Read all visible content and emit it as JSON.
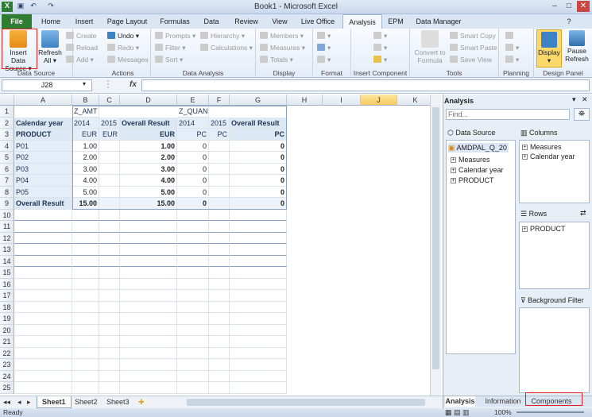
{
  "window": {
    "title": "Book1 - Microsoft Excel"
  },
  "tabs": [
    "File",
    "Home",
    "Insert",
    "Page Layout",
    "Formulas",
    "Data",
    "Review",
    "View",
    "Live Office",
    "Analysis",
    "EPM",
    "Data Manager"
  ],
  "ribbon": {
    "data_source": {
      "label": "Data Source",
      "insert": "Insert Data Source",
      "refresh": "Refresh All"
    },
    "actions": {
      "label": "Actions",
      "create": "Create",
      "reload": "Reload",
      "add": "Add",
      "undo": "Undo",
      "redo": "Redo",
      "messages": "Messages"
    },
    "data_analysis": {
      "label": "Data Analysis",
      "prompts": "Prompts",
      "filter": "Filter",
      "sort": "Sort",
      "hierarchy": "Hierarchy",
      "calculations": "Calculations"
    },
    "display": {
      "label": "Display",
      "members": "Members",
      "measures": "Measures",
      "totals": "Totals"
    },
    "format": {
      "label": "Format"
    },
    "insert_component": {
      "label": "Insert Component"
    },
    "tools": {
      "label": "Tools",
      "convert": "Convert to Formula",
      "smart_copy": "Smart Copy",
      "smart_paste": "Smart Paste",
      "save_view": "Save View"
    },
    "planning": {
      "label": "Planning"
    },
    "design_panel": {
      "label": "Design Panel",
      "display": "Display",
      "pause": "Pause Refresh"
    }
  },
  "formula_bar": {
    "name_box": "J28",
    "fx": "fx",
    "value": ""
  },
  "columns": [
    "A",
    "B",
    "C",
    "D",
    "E",
    "F",
    "G",
    "H",
    "I",
    "J",
    "K"
  ],
  "rows": [
    "1",
    "2",
    "3",
    "4",
    "5",
    "6",
    "7",
    "8",
    "9",
    "10",
    "11",
    "12",
    "13",
    "14",
    "15",
    "16",
    "17",
    "18",
    "19",
    "20",
    "21",
    "22",
    "23",
    "24",
    "25"
  ],
  "table": {
    "r1": {
      "b": "Z_AMT",
      "e": "Z_QUAN"
    },
    "r2": {
      "a": "Calendar year",
      "b": "2014",
      "c": "2015",
      "d": "Overall Result",
      "e": "2014",
      "f": "2015",
      "g": "Overall Result"
    },
    "r3": {
      "a": "PRODUCT",
      "b": "EUR",
      "c": "EUR",
      "d": "EUR",
      "e": "PC",
      "f": "PC",
      "g": "PC"
    },
    "data": [
      {
        "a": "P01",
        "b": "1.00",
        "d": "1.00",
        "e": "0",
        "g": "0"
      },
      {
        "a": "P02",
        "b": "2.00",
        "d": "2.00",
        "e": "0",
        "g": "0"
      },
      {
        "a": "P03",
        "b": "3.00",
        "d": "3.00",
        "e": "0",
        "g": "0"
      },
      {
        "a": "P04",
        "b": "4.00",
        "d": "4.00",
        "e": "0",
        "g": "0"
      },
      {
        "a": "P05",
        "b": "5.00",
        "d": "5.00",
        "e": "0",
        "g": "0"
      }
    ],
    "total": {
      "a": "Overall Result",
      "b": "15.00",
      "d": "15.00",
      "e": "0",
      "g": "0"
    }
  },
  "sheets": [
    "Sheet1",
    "Sheet2",
    "Sheet3"
  ],
  "status": {
    "left": "Ready",
    "zoom": "100%"
  },
  "pane": {
    "title": "Analysis",
    "find_placeholder": "Find...",
    "data_source_label": "Data Source",
    "source_name": "AMDPAL_Q_20",
    "source_items": [
      "Measures",
      "Calendar year",
      "PRODUCT"
    ],
    "columns_label": "Columns",
    "columns_items": [
      "Measures",
      "Calendar year"
    ],
    "rows_label": "Rows",
    "rows_items": [
      "PRODUCT"
    ],
    "filter_label": "Background Filter",
    "tabs": [
      "Analysis",
      "Information",
      "Components"
    ]
  },
  "colors": {
    "accent": "#2e7d32",
    "highlight": "#e0201f",
    "header": "#dde8f5"
  }
}
